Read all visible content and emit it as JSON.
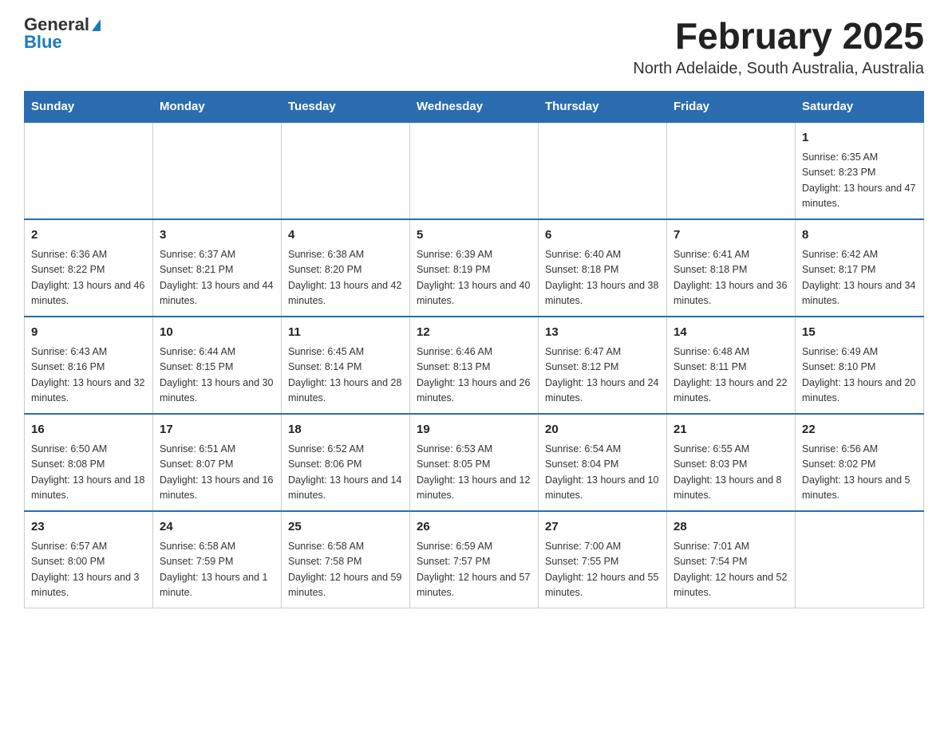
{
  "header": {
    "logo_general": "General",
    "logo_blue": "Blue",
    "title": "February 2025",
    "subtitle": "North Adelaide, South Australia, Australia"
  },
  "weekdays": [
    "Sunday",
    "Monday",
    "Tuesday",
    "Wednesday",
    "Thursday",
    "Friday",
    "Saturday"
  ],
  "weeks": [
    [
      {
        "day": "",
        "info": ""
      },
      {
        "day": "",
        "info": ""
      },
      {
        "day": "",
        "info": ""
      },
      {
        "day": "",
        "info": ""
      },
      {
        "day": "",
        "info": ""
      },
      {
        "day": "",
        "info": ""
      },
      {
        "day": "1",
        "info": "Sunrise: 6:35 AM\nSunset: 8:23 PM\nDaylight: 13 hours and 47 minutes."
      }
    ],
    [
      {
        "day": "2",
        "info": "Sunrise: 6:36 AM\nSunset: 8:22 PM\nDaylight: 13 hours and 46 minutes."
      },
      {
        "day": "3",
        "info": "Sunrise: 6:37 AM\nSunset: 8:21 PM\nDaylight: 13 hours and 44 minutes."
      },
      {
        "day": "4",
        "info": "Sunrise: 6:38 AM\nSunset: 8:20 PM\nDaylight: 13 hours and 42 minutes."
      },
      {
        "day": "5",
        "info": "Sunrise: 6:39 AM\nSunset: 8:19 PM\nDaylight: 13 hours and 40 minutes."
      },
      {
        "day": "6",
        "info": "Sunrise: 6:40 AM\nSunset: 8:18 PM\nDaylight: 13 hours and 38 minutes."
      },
      {
        "day": "7",
        "info": "Sunrise: 6:41 AM\nSunset: 8:18 PM\nDaylight: 13 hours and 36 minutes."
      },
      {
        "day": "8",
        "info": "Sunrise: 6:42 AM\nSunset: 8:17 PM\nDaylight: 13 hours and 34 minutes."
      }
    ],
    [
      {
        "day": "9",
        "info": "Sunrise: 6:43 AM\nSunset: 8:16 PM\nDaylight: 13 hours and 32 minutes."
      },
      {
        "day": "10",
        "info": "Sunrise: 6:44 AM\nSunset: 8:15 PM\nDaylight: 13 hours and 30 minutes."
      },
      {
        "day": "11",
        "info": "Sunrise: 6:45 AM\nSunset: 8:14 PM\nDaylight: 13 hours and 28 minutes."
      },
      {
        "day": "12",
        "info": "Sunrise: 6:46 AM\nSunset: 8:13 PM\nDaylight: 13 hours and 26 minutes."
      },
      {
        "day": "13",
        "info": "Sunrise: 6:47 AM\nSunset: 8:12 PM\nDaylight: 13 hours and 24 minutes."
      },
      {
        "day": "14",
        "info": "Sunrise: 6:48 AM\nSunset: 8:11 PM\nDaylight: 13 hours and 22 minutes."
      },
      {
        "day": "15",
        "info": "Sunrise: 6:49 AM\nSunset: 8:10 PM\nDaylight: 13 hours and 20 minutes."
      }
    ],
    [
      {
        "day": "16",
        "info": "Sunrise: 6:50 AM\nSunset: 8:08 PM\nDaylight: 13 hours and 18 minutes."
      },
      {
        "day": "17",
        "info": "Sunrise: 6:51 AM\nSunset: 8:07 PM\nDaylight: 13 hours and 16 minutes."
      },
      {
        "day": "18",
        "info": "Sunrise: 6:52 AM\nSunset: 8:06 PM\nDaylight: 13 hours and 14 minutes."
      },
      {
        "day": "19",
        "info": "Sunrise: 6:53 AM\nSunset: 8:05 PM\nDaylight: 13 hours and 12 minutes."
      },
      {
        "day": "20",
        "info": "Sunrise: 6:54 AM\nSunset: 8:04 PM\nDaylight: 13 hours and 10 minutes."
      },
      {
        "day": "21",
        "info": "Sunrise: 6:55 AM\nSunset: 8:03 PM\nDaylight: 13 hours and 8 minutes."
      },
      {
        "day": "22",
        "info": "Sunrise: 6:56 AM\nSunset: 8:02 PM\nDaylight: 13 hours and 5 minutes."
      }
    ],
    [
      {
        "day": "23",
        "info": "Sunrise: 6:57 AM\nSunset: 8:00 PM\nDaylight: 13 hours and 3 minutes."
      },
      {
        "day": "24",
        "info": "Sunrise: 6:58 AM\nSunset: 7:59 PM\nDaylight: 13 hours and 1 minute."
      },
      {
        "day": "25",
        "info": "Sunrise: 6:58 AM\nSunset: 7:58 PM\nDaylight: 12 hours and 59 minutes."
      },
      {
        "day": "26",
        "info": "Sunrise: 6:59 AM\nSunset: 7:57 PM\nDaylight: 12 hours and 57 minutes."
      },
      {
        "day": "27",
        "info": "Sunrise: 7:00 AM\nSunset: 7:55 PM\nDaylight: 12 hours and 55 minutes."
      },
      {
        "day": "28",
        "info": "Sunrise: 7:01 AM\nSunset: 7:54 PM\nDaylight: 12 hours and 52 minutes."
      },
      {
        "day": "",
        "info": ""
      }
    ]
  ]
}
